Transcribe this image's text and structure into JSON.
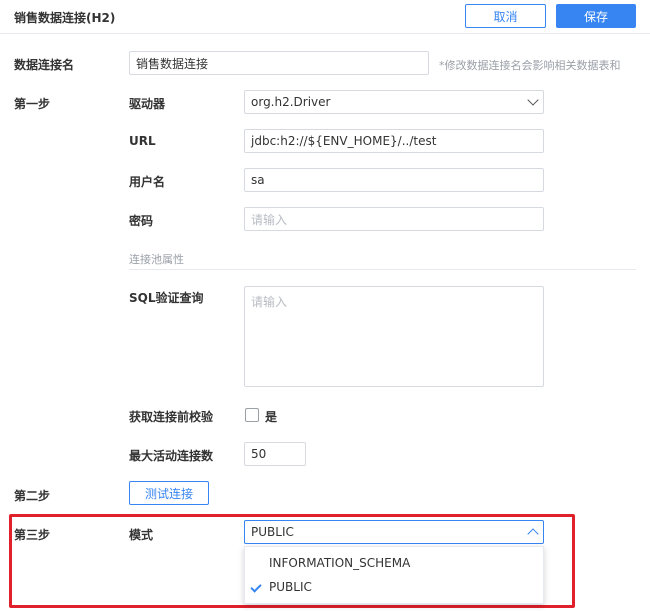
{
  "header": {
    "title": "销售数据连接(H2)",
    "cancel_label": "取消",
    "save_label": "保存"
  },
  "connection_name": {
    "label": "数据连接名",
    "value": "销售数据连接",
    "hint": "*修改数据连接名会影响相关数据表和"
  },
  "step1": {
    "label": "第一步",
    "driver": {
      "label": "驱动器",
      "value": "org.h2.Driver"
    },
    "url": {
      "label": "URL",
      "value": "jdbc:h2://${ENV_HOME}/../test"
    },
    "username": {
      "label": "用户名",
      "value": "sa"
    },
    "password": {
      "label": "密码",
      "placeholder": "请输入"
    },
    "pool_section": "连接池属性",
    "sql_validation": {
      "label": "SQL验证查询",
      "placeholder": "请输入"
    },
    "pre_check": {
      "label": "获取连接前校验",
      "option": "是",
      "checked": false
    },
    "max_active": {
      "label": "最大活动连接数",
      "value": "50"
    }
  },
  "step2": {
    "label": "第二步",
    "test_label": "测试连接"
  },
  "step3": {
    "label": "第三步",
    "schema": {
      "label": "模式",
      "value": "PUBLIC",
      "options": [
        "INFORMATION_SCHEMA",
        "PUBLIC"
      ],
      "selected": "PUBLIC"
    }
  },
  "colors": {
    "accent": "#3685f2",
    "highlight": "#e0202a"
  }
}
